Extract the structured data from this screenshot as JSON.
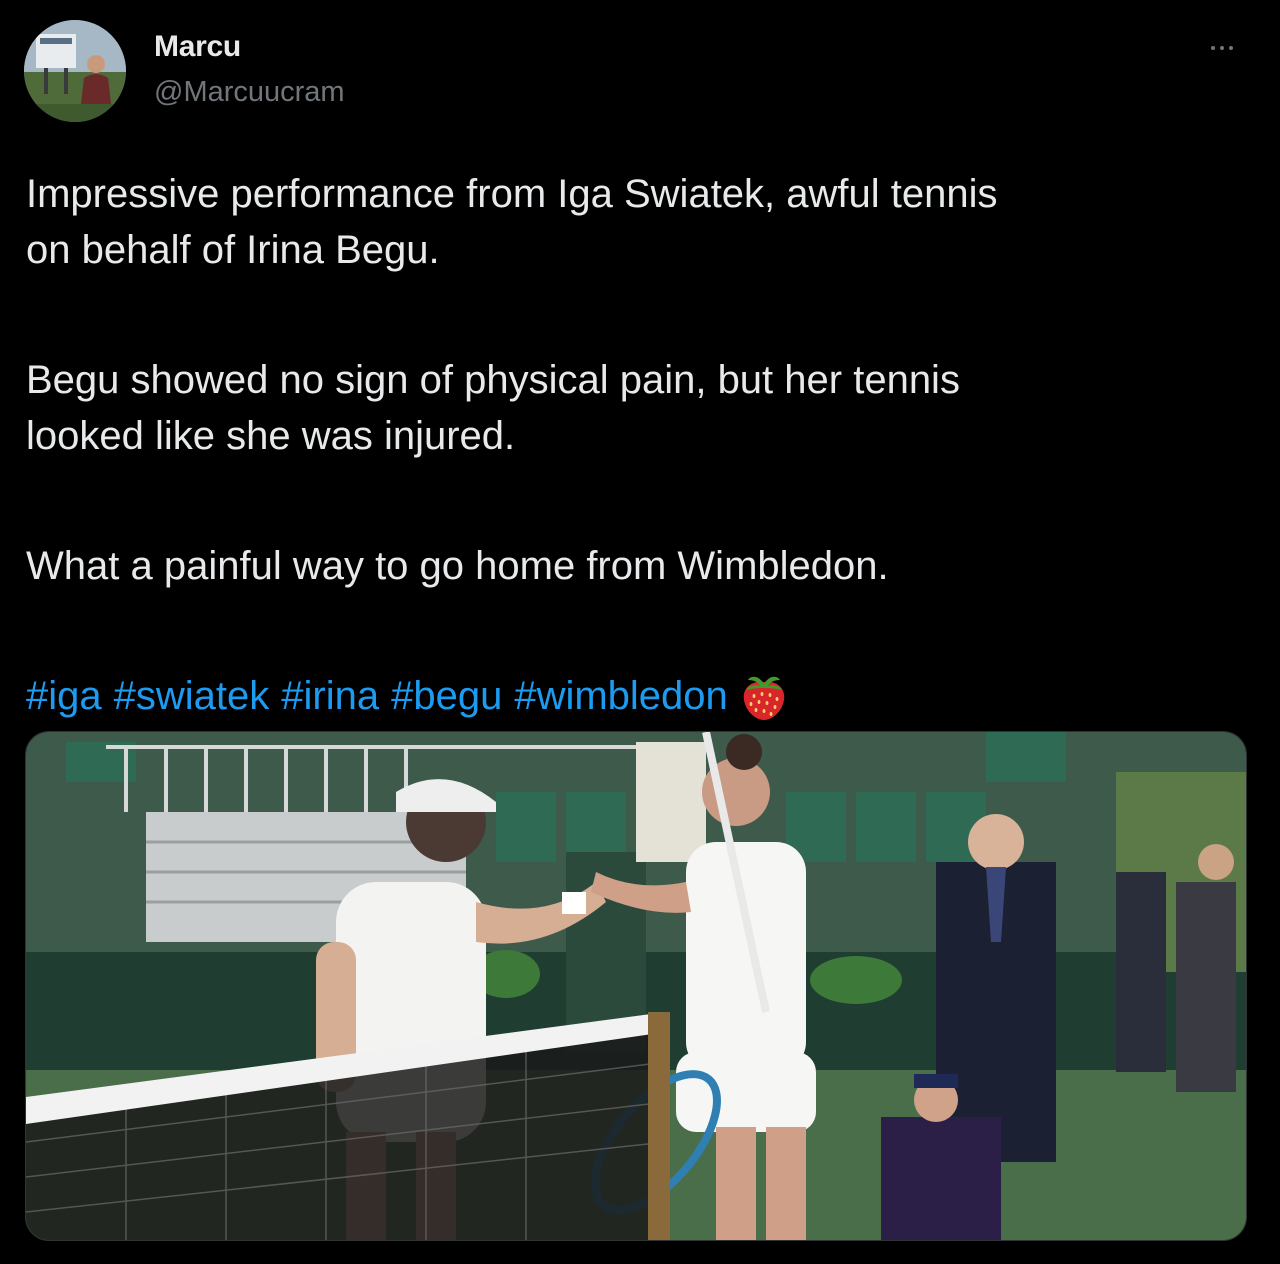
{
  "tweet": {
    "author": {
      "display_name": "Marcu",
      "handle": "@Marcuucram",
      "avatar_icon": "user-avatar-photo"
    },
    "more_icon": "more-horizontal-icon",
    "paragraphs": [
      "Impressive performance from Iga Swiatek, awful tennis on behalf of Irina Begu.",
      "Begu showed no sign of physical pain, but her tennis looked like she was injured.",
      "What a painful way to go home from Wimbledon."
    ],
    "paragraph_lines": [
      [
        "Impressive performance from Iga Swiatek, awful tennis",
        "on behalf of Irina Begu."
      ],
      [
        "Begu showed no sign of physical pain, but her tennis",
        "looked like she was injured."
      ],
      [
        "What a painful way to go home from Wimbledon."
      ]
    ],
    "hashtags": [
      "#iga",
      "#swiatek",
      "#irina",
      "#begu",
      "#wimbledon"
    ],
    "emoji": "strawberry-icon",
    "media": {
      "type": "photo",
      "icon": "photo-tennis-handshake"
    }
  },
  "colors": {
    "background": "#000000",
    "text_primary": "#e7e9ea",
    "text_secondary": "#71767b",
    "link": "#1d9bf0"
  }
}
